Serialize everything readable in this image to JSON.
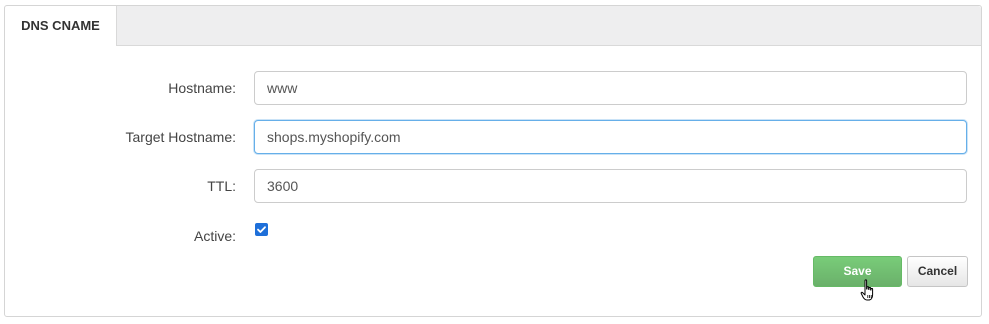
{
  "tabs": [
    {
      "label": "DNS CNAME"
    }
  ],
  "form": {
    "hostname": {
      "label": "Hostname:",
      "value": "www"
    },
    "target_hostname": {
      "label": "Target Hostname:",
      "value": "shops.myshopify.com"
    },
    "ttl": {
      "label": "TTL:",
      "value": "3600"
    },
    "active": {
      "label": "Active:",
      "checked": true
    }
  },
  "buttons": {
    "save_label": "Save",
    "cancel_label": "Cancel"
  },
  "colors": {
    "save_green": "#5cb85c",
    "checkbox_blue": "#1e6fd9",
    "focus_border": "#66afe9"
  },
  "icons": {
    "pointer": "hand-pointer-icon",
    "check": "checkmark-icon"
  }
}
